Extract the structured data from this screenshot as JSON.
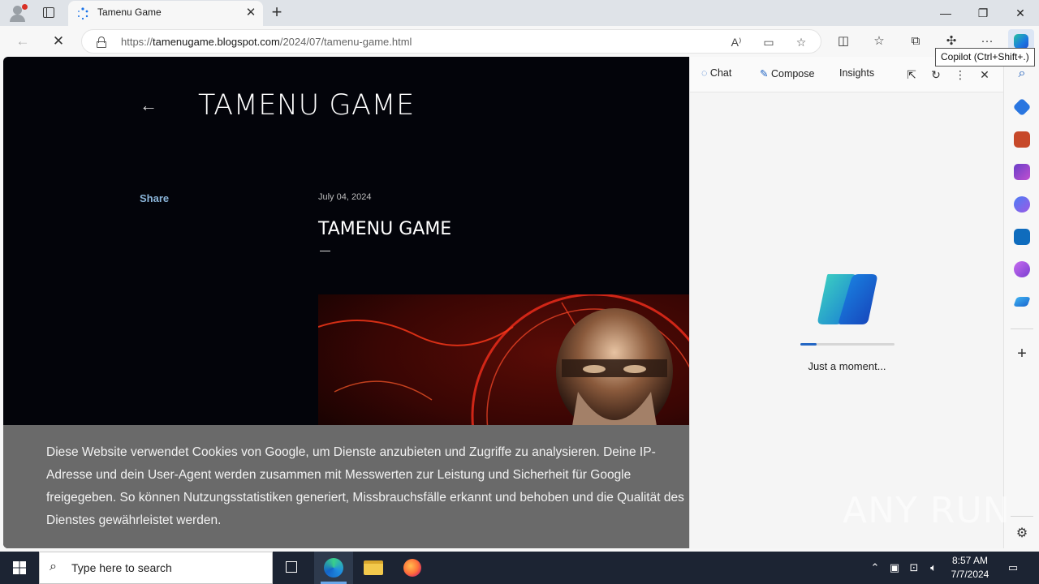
{
  "browser": {
    "tab": {
      "title": "Tamenu Game"
    },
    "address": {
      "scheme": "https://",
      "host": "tamenugame.blogspot.com",
      "path": "/2024/07/tamenu-game.html"
    },
    "tooltip": "Copilot (Ctrl+Shift+.)",
    "accent": "#2366c4"
  },
  "page": {
    "blog_title": "TAMENU GAME",
    "share_label": "Share",
    "post_date": "July 04, 2024",
    "post_title": "TAMENU GAME",
    "cookie_text": "Diese Website verwendet Cookies von Google, um Dienste anzubieten und Zugriffe zu analysieren. Deine IP-Adresse und dein User-Agent werden zusammen mit Messwerten zur Leistung und Sicherheit für Google freigegeben. So können Nutzungsstatistiken generiert, Missbrauchsfälle erkannt und behoben und die Qualität des Dienstes gewährleistet werden."
  },
  "copilot": {
    "tabs": {
      "chat": "Chat",
      "compose": "Compose",
      "insights": "Insights"
    },
    "status": "Just a moment...",
    "progress": 0.17
  },
  "taskbar": {
    "search_placeholder": "Type here to search",
    "time": "8:57 AM",
    "date": "7/7/2024"
  },
  "watermark": "ANY RUN"
}
